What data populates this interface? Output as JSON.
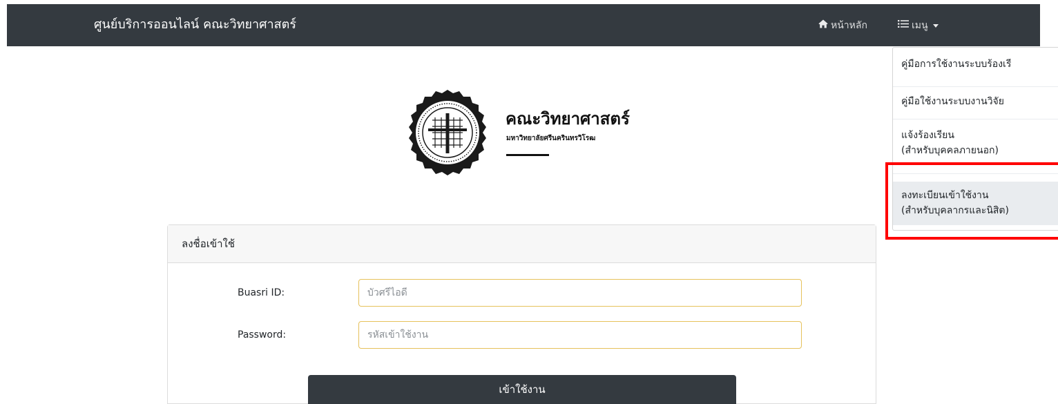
{
  "navbar": {
    "brand": "ศูนย์บริการออนไลน์ คณะวิทยาศาสตร์",
    "home_label": "หน้าหลัก",
    "home_icon": "home-icon",
    "menu_label": "เมนู",
    "menu_icon": "list-icon"
  },
  "dropdown": {
    "items": [
      {
        "label": "คู่มือการใช้งานระบบร้องเรี"
      },
      {
        "label_line1": "คู่มือใช้งานระบบงานวิจัย"
      },
      {
        "label_line1": "แจ้งร้องเรียน",
        "label_line2": "(สำหรับบุคคลภายนอก)"
      },
      {
        "label_line1": "ลงทะเบียนเข้าใช้งาน",
        "label_line2": "(สำหรับบุคลากรและนิสิต)"
      }
    ],
    "active_index": 3,
    "highlight_color": "#ff0000"
  },
  "logo": {
    "title": "คณะวิทยาศาสตร์",
    "subtitle": "มหาวิทยาลัยศรีนครินทรวิโรฒ"
  },
  "login": {
    "header": "ลงชื่อเข้าใช้",
    "id_label": "Buasri ID:",
    "id_placeholder": "บัวศรีไอดี",
    "password_label": "Password:",
    "password_placeholder": "รหัสเข้าใช้งาน",
    "submit_label": "เข้าใช้งาน"
  },
  "colors": {
    "navbar_bg": "#343a40",
    "input_border": "#e6c15a",
    "active_item_bg": "#e9ecef"
  }
}
